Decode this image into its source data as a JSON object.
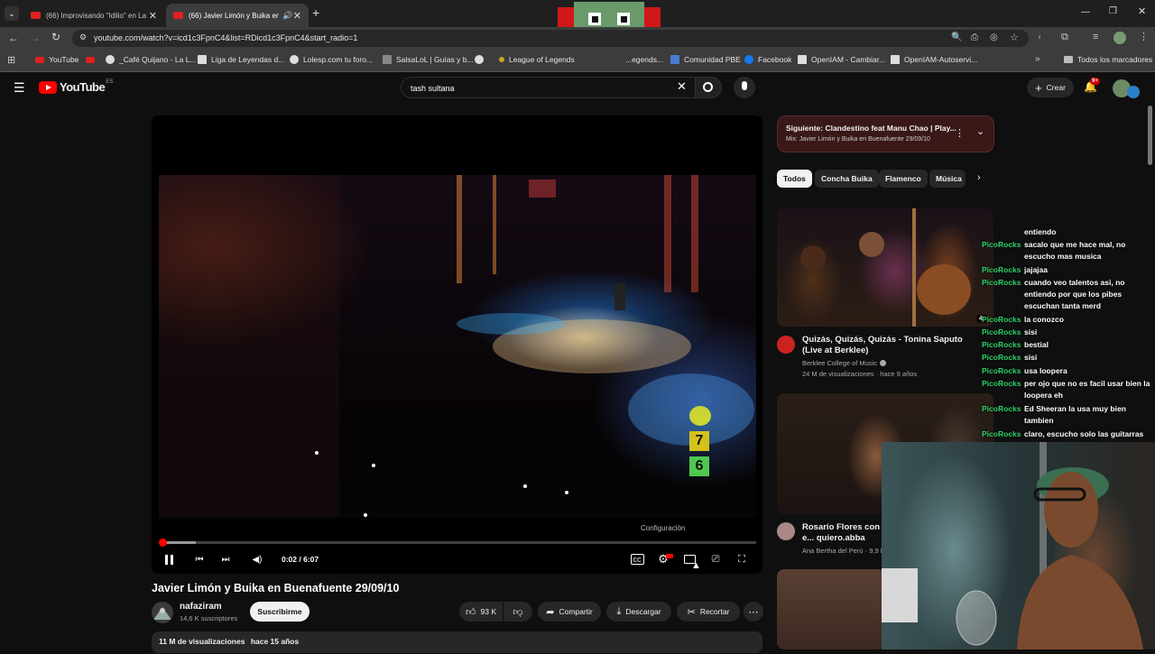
{
  "browser": {
    "tabs": [
      {
        "title": "(66) Improvisando \"Idilio\" en La"
      },
      {
        "title": "(66) Javier Limón y Buika en"
      }
    ],
    "url": "youtube.com/watch?v=icd1c3FpnC4&list=RDicd1c3FpnC4&start_radio=1",
    "bookmarks": [
      "YouTube",
      "_Café Quijano - La L...",
      "Liga de Leyendas d...",
      "Lolesp.com tu foro...",
      "SalsaLoL | Guías y b...",
      "League of Legends",
      "...egends...",
      "Comunidad PBE",
      "Facebook",
      "OpenIAM - Cambiar...",
      "OpenIAM-Autoservi...",
      "Todos los marcadores"
    ]
  },
  "youtube": {
    "logo": "YouTube",
    "region": "ES",
    "search_query": "tash sultana",
    "create_label": "Crear",
    "notif_count": "9+"
  },
  "player": {
    "time": "0:02 / 6:07",
    "progress_fraction": 0.0054,
    "tooltip": "Configuración",
    "channel_logo_number": "7",
    "channel_logo_alt": "6"
  },
  "video": {
    "title": "Javier Limón y Buika en Buenafuente 29/09/10",
    "channel": "nafaziram",
    "subscribers": "14,6 K suscriptores",
    "subscribe_label": "Suscribirme",
    "likes": "93 K",
    "share_label": "Compartir",
    "download_label": "Descargar",
    "clip_label": "Recortar",
    "views": "11 M de visualizaciones",
    "age": "hace 15 años"
  },
  "upnext": {
    "title": "Siguiente: Clandestino feat Manu Chao | Play...",
    "subtitle": "Mix: Javier Limón y Buika en Buenafuente 29/09/10"
  },
  "chips": [
    "Todos",
    "Concha Buika",
    "Flamenco",
    "Música"
  ],
  "recommended": [
    {
      "title": "Quizás, Quizás, Quizás - Tonina Saputo (Live at Berklee)",
      "channel": "Berklee College of Music",
      "meta": "24 M de visualizaciones · hace 9 años",
      "duration": "4:"
    },
    {
      "title": "Rosario Flores con e... quiero.abba",
      "channel": "Ana Bertha del Perú · 9,9 M"
    }
  ],
  "chat": [
    {
      "user": "",
      "msg": "entiendo"
    },
    {
      "user": "PicoRocks",
      "msg": "sacalo que me hace mal, no escucho mas musica"
    },
    {
      "user": "PicoRocks",
      "msg": "jajajaa"
    },
    {
      "user": "PicoRocks",
      "msg": "cuando veo talentos asi, no entiendo por que los pibes escuchan tanta merd"
    },
    {
      "user": "PicoRocks",
      "msg": "la conozco"
    },
    {
      "user": "PicoRocks",
      "msg": "sisi"
    },
    {
      "user": "PicoRocks",
      "msg": "bestial"
    },
    {
      "user": "PicoRocks",
      "msg": "sisi"
    },
    {
      "user": "PicoRocks",
      "msg": "usa loopera"
    },
    {
      "user": "PicoRocks",
      "msg": "per ojo que no es facil usar bien la loopera eh"
    },
    {
      "user": "PicoRocks",
      "msg": "Ed Sheeran la usa muy bien tambien"
    },
    {
      "user": "PicoRocks",
      "msg": "claro, escucho solo las guitarras"
    }
  ]
}
